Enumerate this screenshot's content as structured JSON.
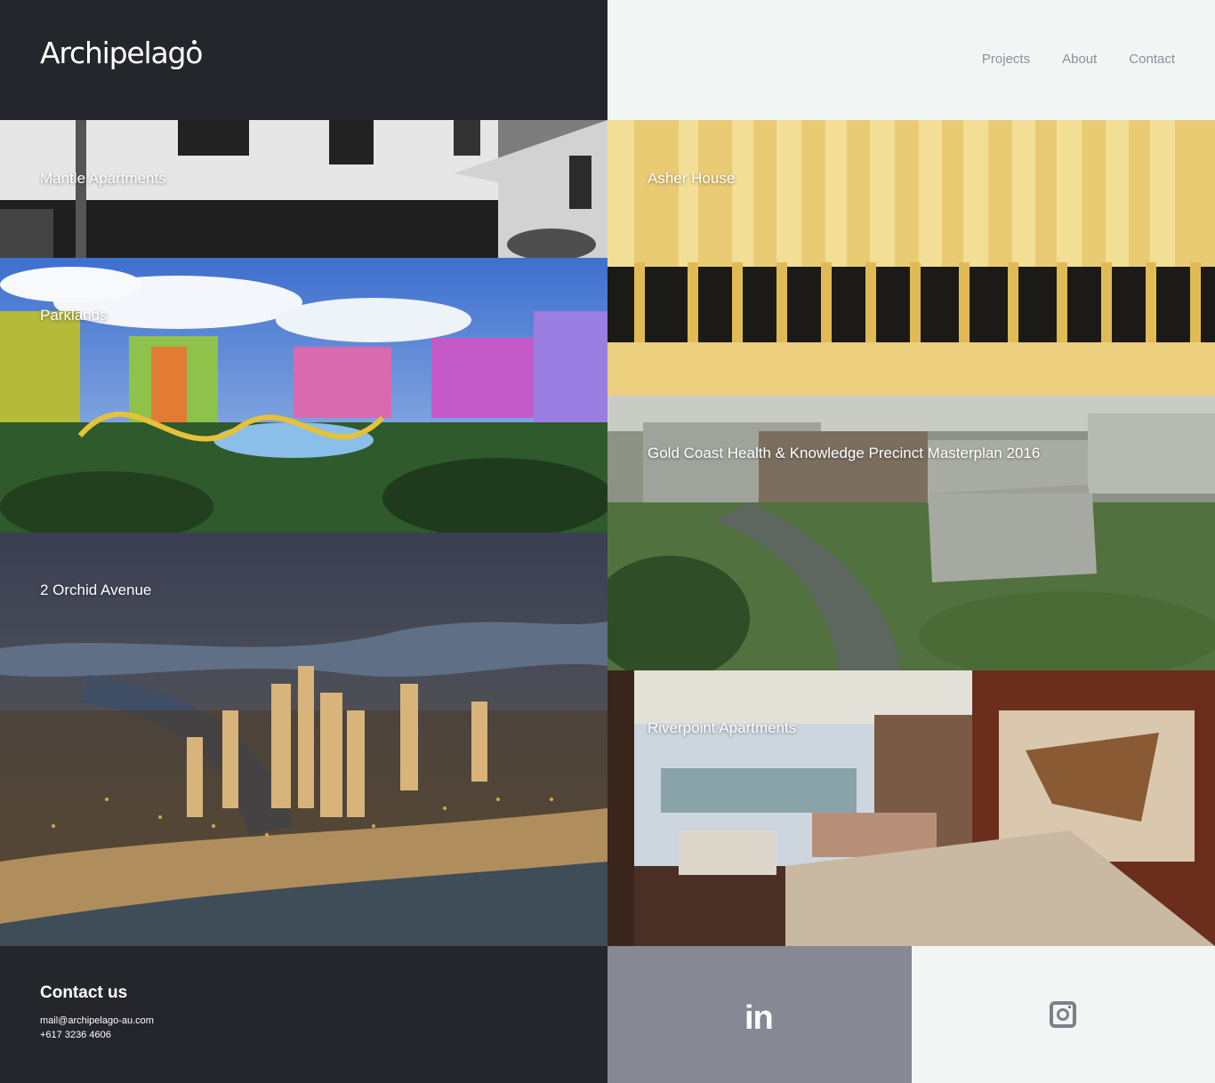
{
  "brand": {
    "name": "Archipelago"
  },
  "nav": {
    "items": [
      "Projects",
      "About",
      "Contact"
    ]
  },
  "projects": [
    {
      "title": "Mantle Apartments"
    },
    {
      "title": "Asher House"
    },
    {
      "title": "Parklands"
    },
    {
      "title": "Gold Coast Health & Knowledge Precinct Masterplan 2016"
    },
    {
      "title": "2 Orchid Avenue"
    },
    {
      "title": "Riverpoint Apartments"
    }
  ],
  "footer": {
    "heading": "Contact us",
    "email": "mail@archipelago-au.com",
    "phone": "+617 3236 4606",
    "social": [
      {
        "name": "linkedin-icon",
        "glyph": "in"
      },
      {
        "name": "instagram-icon"
      }
    ]
  },
  "colors": {
    "dark": "#25252c",
    "light": "#f1f5f4",
    "nav_text": "#8c8f98",
    "linkedin_bg": "#868894"
  }
}
